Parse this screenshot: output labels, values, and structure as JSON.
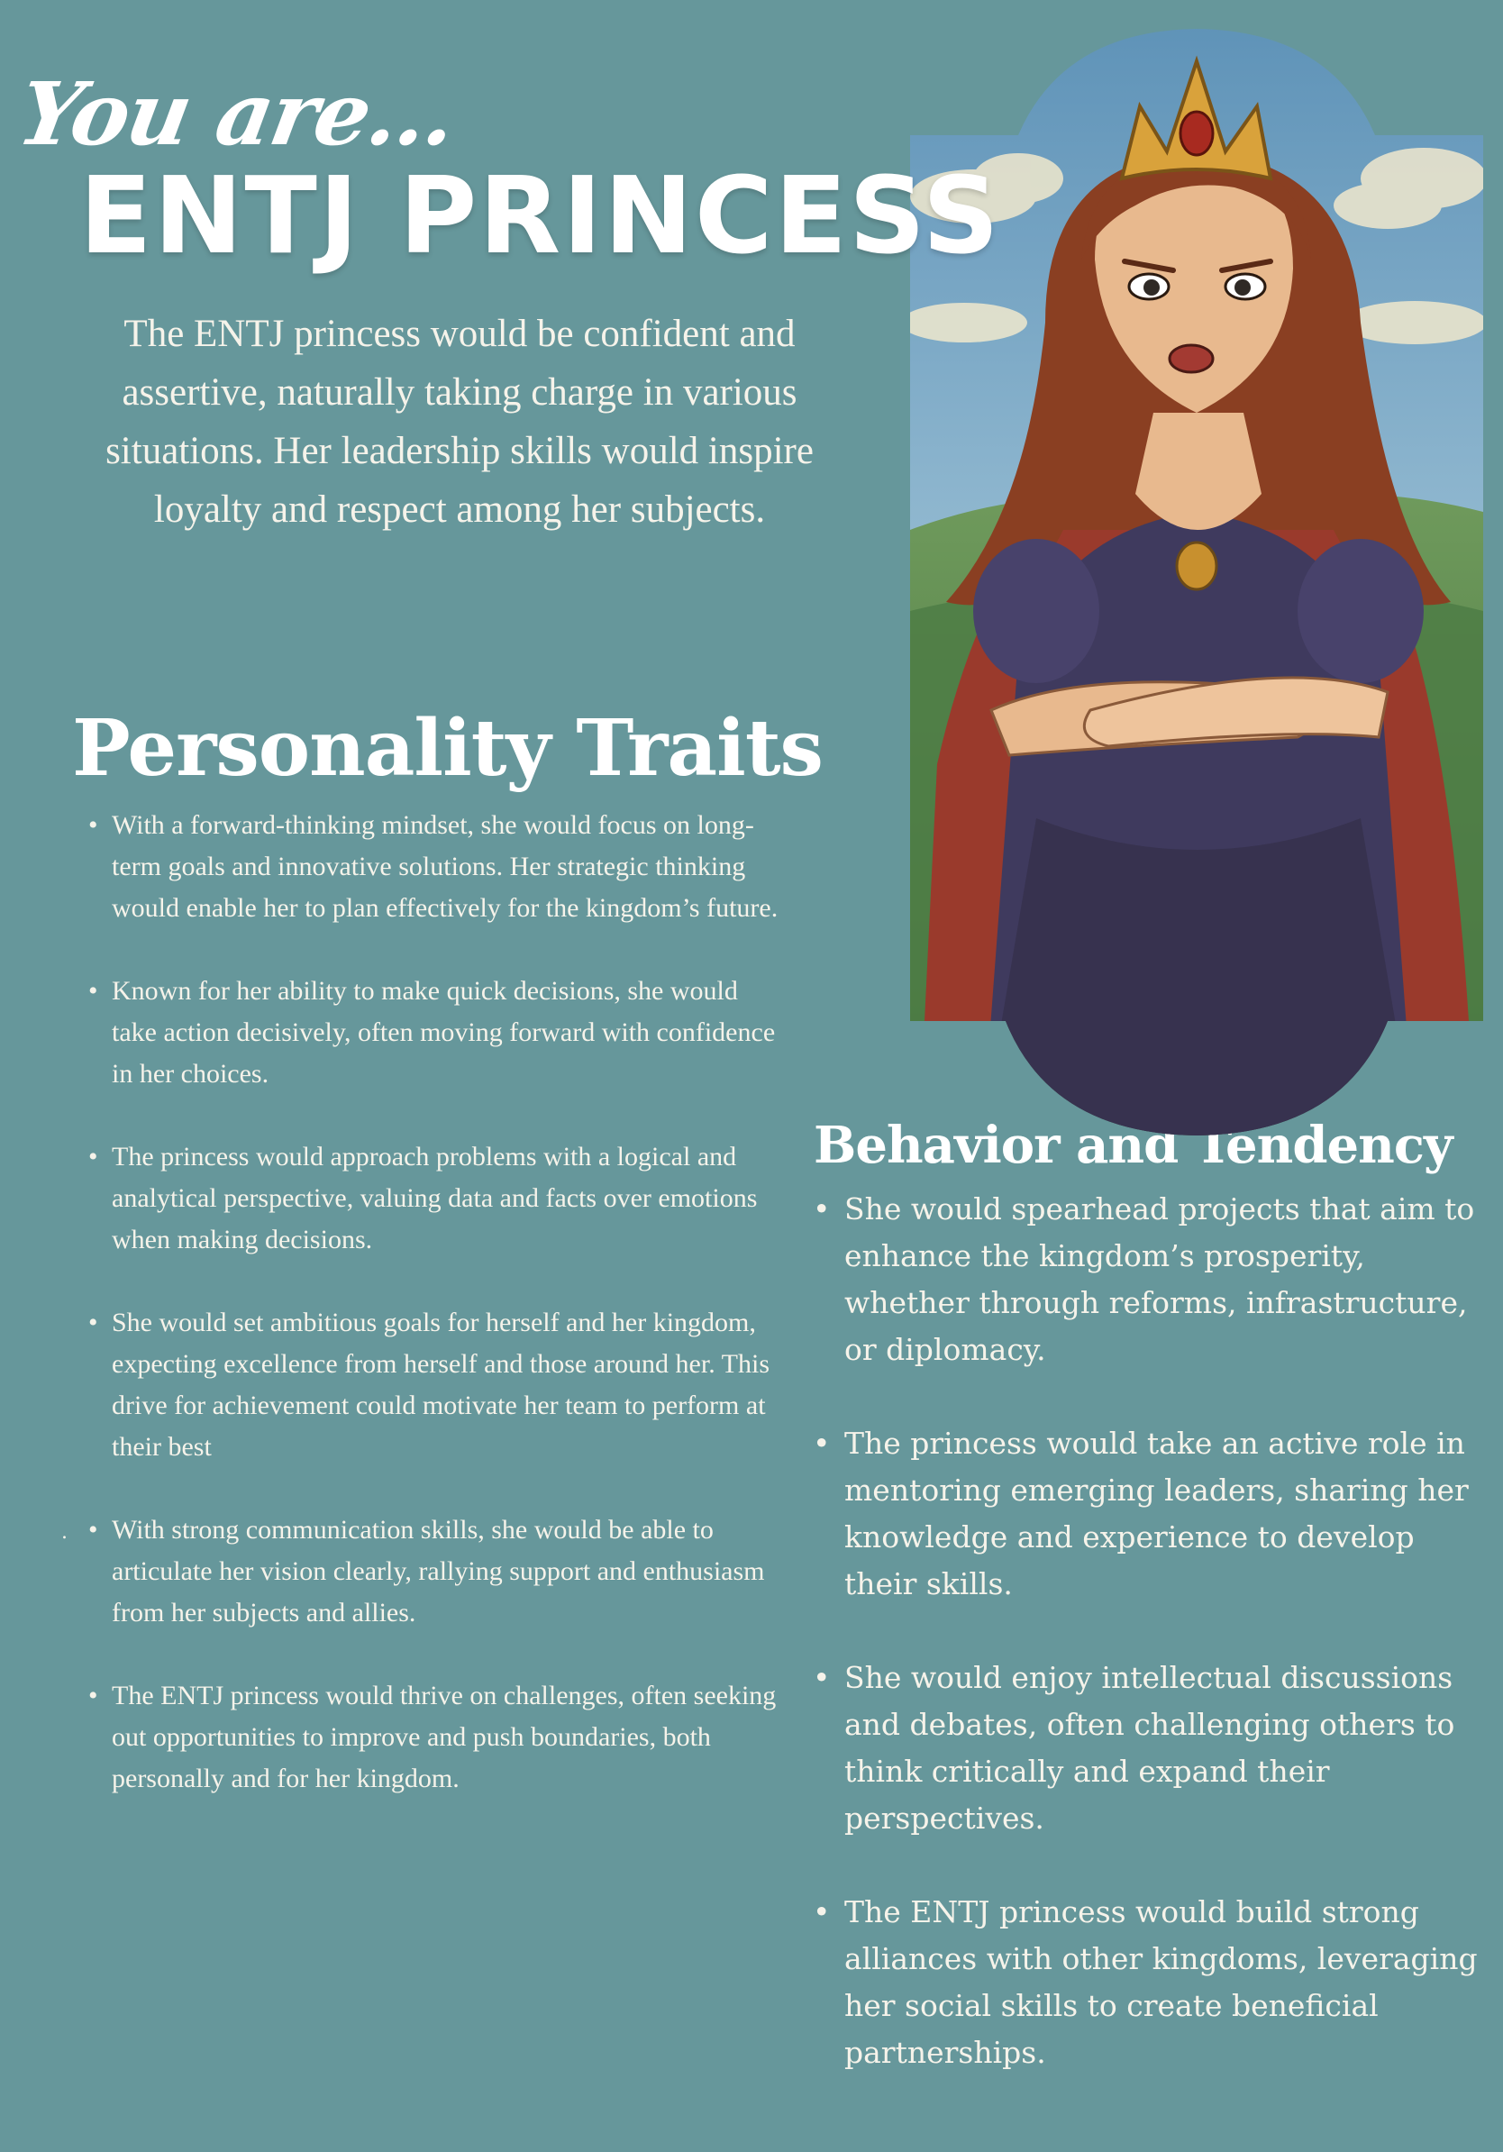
{
  "header": {
    "kicker": "You are...",
    "title": "ENTJ PRINCESS",
    "intro": "The ENTJ princess would be confident and assertive, naturally taking charge in various situations. Her leadership skills would inspire loyalty and respect among her subjects."
  },
  "traits": {
    "title": "Personality Traits",
    "items": [
      "With a forward-thinking mindset, she would focus on long-term goals and innovative solutions. Her strategic thinking would enable her to plan effectively for the kingdom’s future.",
      "Known for her ability to make quick decisions, she would take action decisively, often moving forward with confidence in her choices.",
      "The princess would approach problems with a logical and analytical perspective, valuing data and facts over emotions when making decisions.",
      "She would set ambitious goals for herself and her kingdom, expecting excellence from herself and those around her. This drive for achievement could motivate her team to perform at their best",
      "With strong communication skills, she would be able to articulate her vision clearly, rallying support and enthusiasm from her subjects and allies.",
      "The ENTJ princess would thrive on challenges, often seeking out opportunities to improve and push boundaries, both personally and for her kingdom."
    ],
    "stray_mark": "."
  },
  "behavior": {
    "title": "Behavior and Tendency",
    "items": [
      "She would spearhead projects that aim to enhance the kingdom’s prosperity, whether through reforms, infrastructure, or diplomacy.",
      "The princess would take an active role in mentoring emerging leaders, sharing her knowledge and experience to develop their skills.",
      "She would enjoy intellectual discussions and debates, often challenging others to think critically and expand their perspectives.",
      "The ENTJ princess would build strong alliances with other kingdoms, leveraging her social skills to create beneficial partnerships."
    ]
  },
  "bullet_glyph": "•",
  "colors": {
    "background": "#66979b",
    "text": "#f6f3ea",
    "dress": "#3f3a5e",
    "hair": "#8a3f22",
    "crown": "#d9a23b",
    "cape": "#9a3a2c"
  }
}
